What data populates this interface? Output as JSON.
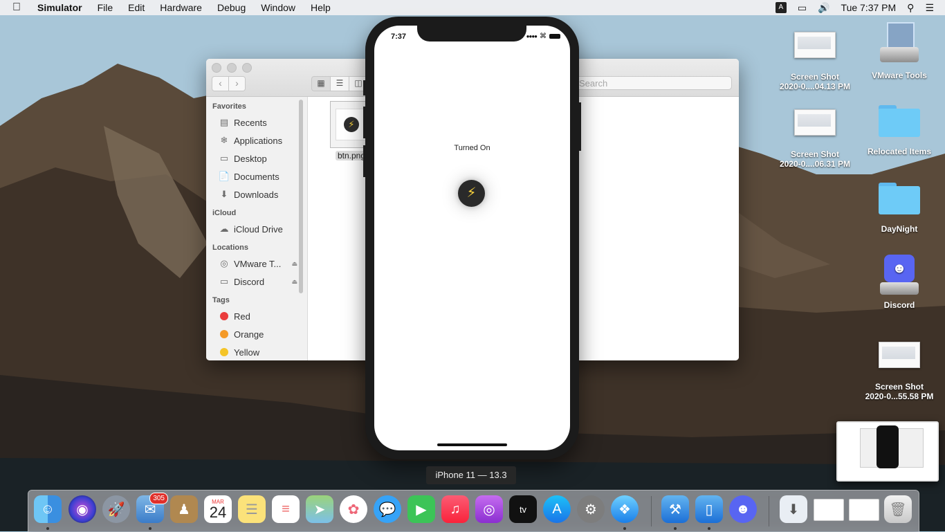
{
  "menubar": {
    "app_name": "Simulator",
    "items": [
      "File",
      "Edit",
      "Hardware",
      "Debug",
      "Window",
      "Help"
    ],
    "input_source": "A",
    "clock": "Tue 7:37 PM"
  },
  "finder": {
    "search_placeholder": "Search",
    "sidebar": {
      "favorites_header": "Favorites",
      "favorites": [
        "Recents",
        "Applications",
        "Desktop",
        "Documents",
        "Downloads"
      ],
      "icloud_header": "iCloud",
      "icloud": [
        "iCloud Drive"
      ],
      "locations_header": "Locations",
      "locations": [
        "VMware T...",
        "Discord"
      ],
      "tags_header": "Tags",
      "tags": [
        {
          "label": "Red",
          "color": "#ea3c3c"
        },
        {
          "label": "Orange",
          "color": "#f49a28"
        },
        {
          "label": "Yellow",
          "color": "#f4c428"
        }
      ]
    },
    "files": [
      {
        "name": "btn.png"
      }
    ]
  },
  "simulator": {
    "status_time": "7:37",
    "status_text": "Turned On",
    "device_label": "iPhone 11 — 13.3",
    "bolt_color": "#f9d23c"
  },
  "desktop": {
    "icons": [
      {
        "line1": "Screen Shot",
        "line2": "2020-0....04.13 PM"
      },
      {
        "line1": "VMware Tools",
        "line2": ""
      },
      {
        "line1": "Screen Shot",
        "line2": "2020-0....06.31 PM"
      },
      {
        "line1": "Relocated Items",
        "line2": ""
      },
      {
        "line1": "DayNight",
        "line2": ""
      },
      {
        "line1": "Discord",
        "line2": ""
      },
      {
        "line1": "Screen Shot",
        "line2": "2020-0...55.58 PM"
      }
    ]
  },
  "dock": {
    "mail_badge": "305",
    "calendar_month": "MAR",
    "calendar_day": "24",
    "apps": [
      "Finder",
      "Siri",
      "Launchpad",
      "Mail",
      "Contacts",
      "Calendar",
      "Notes",
      "Reminders",
      "Maps",
      "Photos",
      "Messages",
      "FaceTime",
      "Music",
      "Podcasts",
      "TV",
      "App Store",
      "System Preferences",
      "Safari",
      "Xcode",
      "Simulator",
      "Discord",
      "Downloads",
      "Screenshot",
      "Screenshot",
      "Trash"
    ]
  }
}
